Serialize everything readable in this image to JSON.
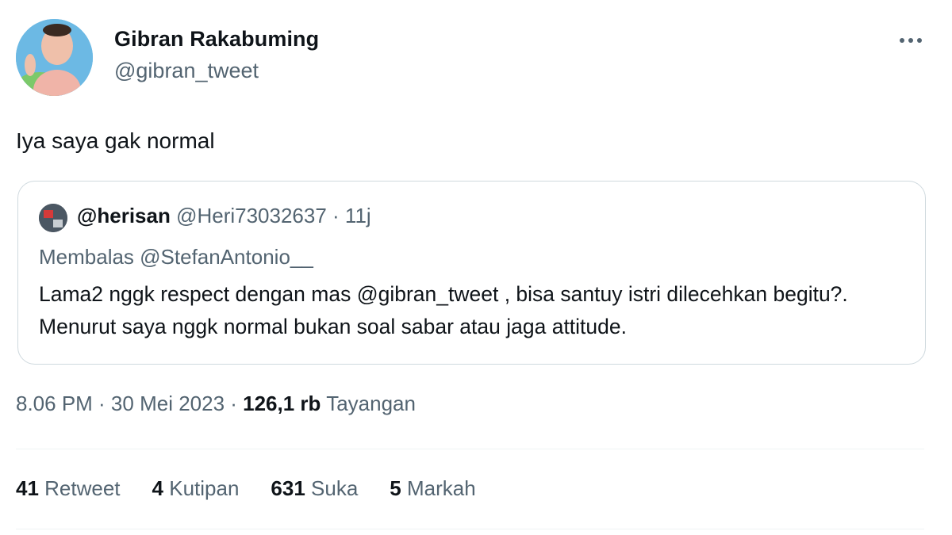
{
  "author": {
    "display_name": "Gibran Rakabuming",
    "handle": "@gibran_tweet"
  },
  "tweet": {
    "text": "Iya saya gak normal"
  },
  "quoted_tweet": {
    "name": "@herisan",
    "meta": " @Heri73032637 · 11j",
    "reply_to": "Membalas @StefanAntonio__",
    "body": "Lama2 nggk respect dengan mas @gibran_tweet , bisa santuy istri dilecehkan begitu?. Menurut saya nggk normal bukan soal sabar atau jaga attitude."
  },
  "timestamp": {
    "time_date": "8.06 PM · 30 Mei 2023 · ",
    "views_count": "126,1 rb",
    "views_label": " Tayangan"
  },
  "stats": [
    {
      "count": "41",
      "label": " Retweet"
    },
    {
      "count": "4",
      "label": " Kutipan"
    },
    {
      "count": "631",
      "label": " Suka"
    },
    {
      "count": "5",
      "label": " Markah"
    }
  ],
  "icons": {
    "more": "more-horizontal-icon"
  },
  "colors": {
    "text_primary": "#0f1419",
    "text_secondary": "#536471",
    "border": "#cfd9de"
  }
}
